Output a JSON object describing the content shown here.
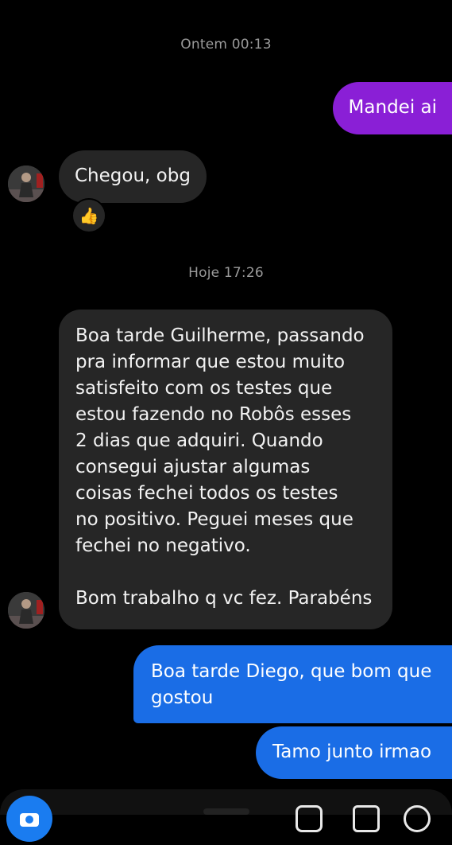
{
  "timestamps": {
    "yesterday": "Ontem 00:13",
    "today": "Hoje 17:26"
  },
  "messages": [
    {
      "direction": "outgoing",
      "text": "Mandei ai"
    },
    {
      "direction": "incoming",
      "text": "Chegou, obg",
      "reaction": "👍"
    },
    {
      "direction": "incoming",
      "text": "Boa tarde Guilherme, passando\npra informar que estou muito\nsatisfeito com os testes que\nestou fazendo no Robôs esses\n2 dias que adquiri. Quando\nconsegui ajustar algumas\ncoisas fechei todos os testes\nno positivo. Peguei meses que\nfechei no negativo.\n\nBom trabalho q vc fez. Parabéns"
    },
    {
      "direction": "outgoing",
      "text": "Boa tarde Diego, que bom que\ngostou"
    },
    {
      "direction": "outgoing",
      "text": "Tamo junto irmao"
    }
  ],
  "colors": {
    "outgoing_first": "#8a1fd6",
    "outgoing_blue": "#1a6de6",
    "incoming": "#262626",
    "background": "#000000"
  },
  "icons": {
    "avatar": "contact-avatar",
    "camera": "camera-icon"
  }
}
